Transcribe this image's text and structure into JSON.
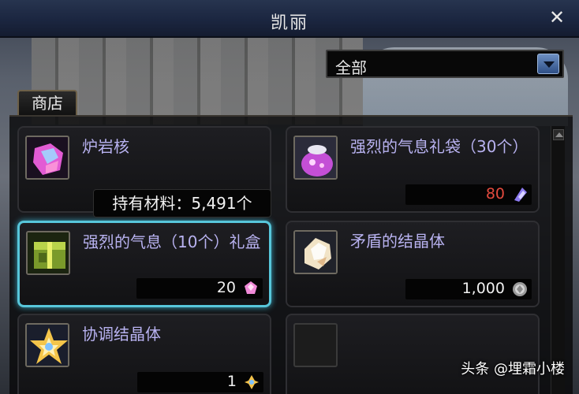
{
  "window": {
    "title": "凯丽"
  },
  "filter": {
    "selected": "全部"
  },
  "tabs": {
    "shop_label": "商店"
  },
  "items": [
    {
      "name": "炉岩核",
      "price": "",
      "currency_icon": "none",
      "icon": "pink-gem-icon"
    },
    {
      "name": "强烈的气息礼袋（30个）",
      "price": "80",
      "price_color": "#e34a3e",
      "currency_icon": "shard-icon",
      "icon": "pouch-icon"
    },
    {
      "name": "强烈的气息（10个）礼盒",
      "price": "20",
      "currency_icon": "pink-gem-icon",
      "icon": "gift-box-icon",
      "selected": true
    },
    {
      "name": "矛盾的结晶体",
      "price": "1,000",
      "currency_icon": "crystal-coin-icon",
      "icon": "crystal-icon"
    },
    {
      "name": "协调结晶体",
      "price": "1",
      "currency_icon": "gold-crystal-icon",
      "icon": "star-crystal-icon"
    },
    {
      "name": "",
      "price": "",
      "icon": "empty-slot"
    }
  ],
  "tooltip": {
    "text": "持有材料：5,491个"
  },
  "watermark": {
    "text": "头条 @埋霜小楼"
  }
}
